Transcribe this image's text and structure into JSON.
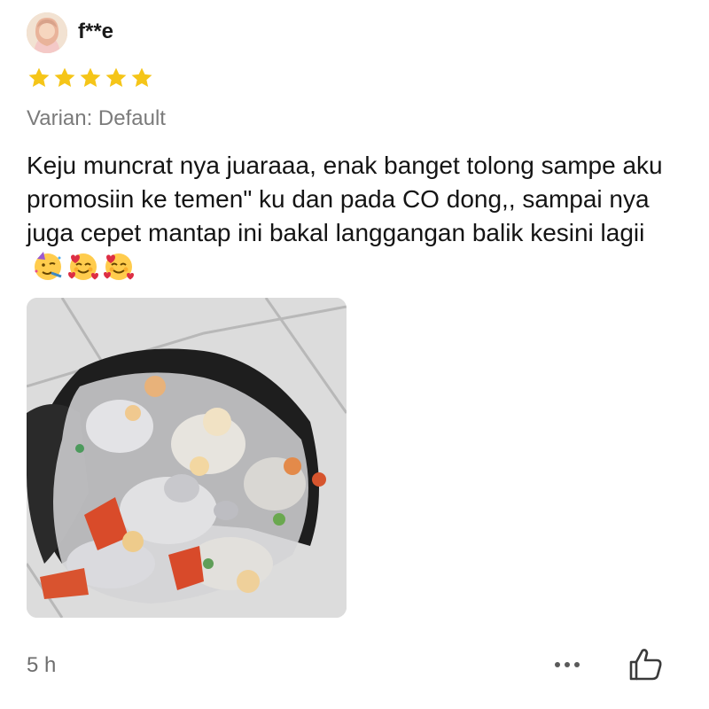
{
  "review": {
    "username": "f**e",
    "rating": 5,
    "rating_max": 5,
    "variant": "Varian: Default",
    "text": "Keju muncrat nya juaraaa, enak banget tolong sampe aku promosiin ke temen\" ku dan pada CO dong,, sampai nya juga cepet mantap ini bakal langgangan balik kesini lagii",
    "emojis": [
      "partying-face",
      "smiling-face-with-hearts",
      "smiling-face-with-hearts"
    ],
    "time": "5 h"
  },
  "colors": {
    "star": "#f5c518",
    "variant_text": "#7b7b7b",
    "muted_text": "#6e6e6e"
  },
  "icons": {
    "more": "more-horizontal-icon",
    "like": "thumbs-up-outline-icon"
  }
}
